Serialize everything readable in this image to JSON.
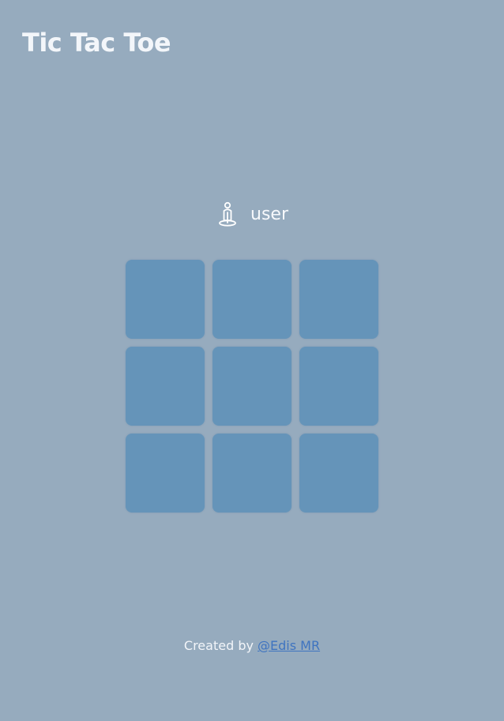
{
  "app": {
    "title": "Tic Tac Toe"
  },
  "player": {
    "icon": "person-icon",
    "label": "user"
  },
  "board": {
    "cells": [
      "",
      "",
      "",
      "",
      "",
      "",
      "",
      "",
      ""
    ],
    "cell_color": "#6594b9"
  },
  "footer": {
    "prefix": "Created by ",
    "author_link": "@Edis MR",
    "link_color": "#3f74c0"
  },
  "colors": {
    "background": "#96abbe",
    "text": "#ffffff"
  }
}
